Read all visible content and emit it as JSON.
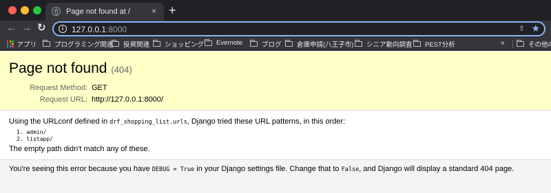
{
  "browser": {
    "tab": {
      "title": "Page not found at /",
      "close_label": "×"
    },
    "new_tab_label": "+",
    "address": {
      "host": "127.0.0.1",
      "port": ":8000"
    },
    "bookmarks": {
      "apps_label": "アプリ",
      "items": [
        "プログラミング関連",
        "投資関連",
        "ショッピング",
        "Evernote",
        "ブログ",
        "倉庫申請(八王子市)",
        "シニア動向調査",
        "PEST分析"
      ],
      "more_label": "»",
      "other_label": "その他のブ"
    },
    "colors": {
      "accent": "#8ab4f8",
      "chrome_dark": "#202124",
      "chrome_toolbar": "#35363a"
    }
  },
  "page": {
    "title": "Page not found",
    "status": "(404)",
    "request_method_label": "Request Method:",
    "request_method": "GET",
    "request_url_label": "Request URL:",
    "request_url": "http://127.0.0.1:8000/",
    "urlconf_prefix": "Using the URLconf defined in ",
    "urlconf_module": "drf_shopping_list.urls",
    "urlconf_suffix": ", Django tried these URL patterns, in this order:",
    "patterns": [
      "1.  admin/",
      "2.  listapp/"
    ],
    "no_match": "The empty path didn't match any of these.",
    "debug_prefix": "You're seeing this error because you have ",
    "debug_code": "DEBUG = True",
    "debug_middle": " in your Django settings file. Change that to ",
    "false_code": "False",
    "debug_suffix": ", and Django will display a standard 404 page.",
    "colors": {
      "summary_bg": "#ffffc8",
      "explanation_bg": "#f4f4f4"
    }
  }
}
